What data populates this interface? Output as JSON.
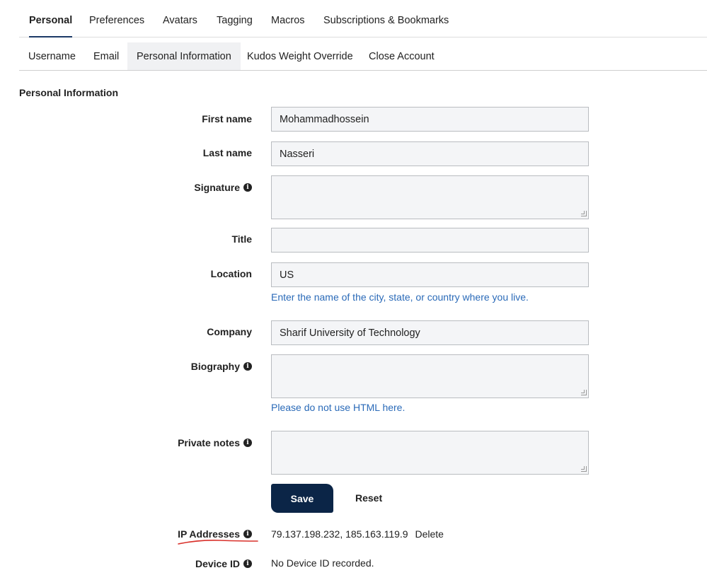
{
  "tabs_primary": [
    "Personal",
    "Preferences",
    "Avatars",
    "Tagging",
    "Macros",
    "Subscriptions & Bookmarks"
  ],
  "tabs_secondary": [
    "Username",
    "Email",
    "Personal Information",
    "Kudos Weight Override",
    "Close Account"
  ],
  "section_title": "Personal Information",
  "form": {
    "first_name_label": "First name",
    "first_name_value": "Mohammadhossein",
    "last_name_label": "Last name",
    "last_name_value": "Nasseri",
    "signature_label": "Signature",
    "signature_value": "",
    "title_label": "Title",
    "title_value": "",
    "location_label": "Location",
    "location_value": "US",
    "location_help": "Enter the name of the city, state, or country where you live.",
    "company_label": "Company",
    "company_value": "Sharif University of Technology",
    "biography_label": "Biography",
    "biography_value": "",
    "biography_help": "Please do not use HTML here.",
    "private_notes_label": "Private notes",
    "private_notes_value": "",
    "save_label": "Save",
    "reset_label": "Reset",
    "ip_label": "IP Addresses",
    "ip_value": "79.137.198.232, 185.163.119.9",
    "ip_delete": "Delete",
    "device_label": "Device ID",
    "device_value": "No Device ID recorded."
  },
  "icons": {
    "info": "info-circle-icon"
  },
  "colors": {
    "accent": "#0b2547",
    "help_text": "#2a6ab8",
    "annotation": "#d9302a"
  }
}
